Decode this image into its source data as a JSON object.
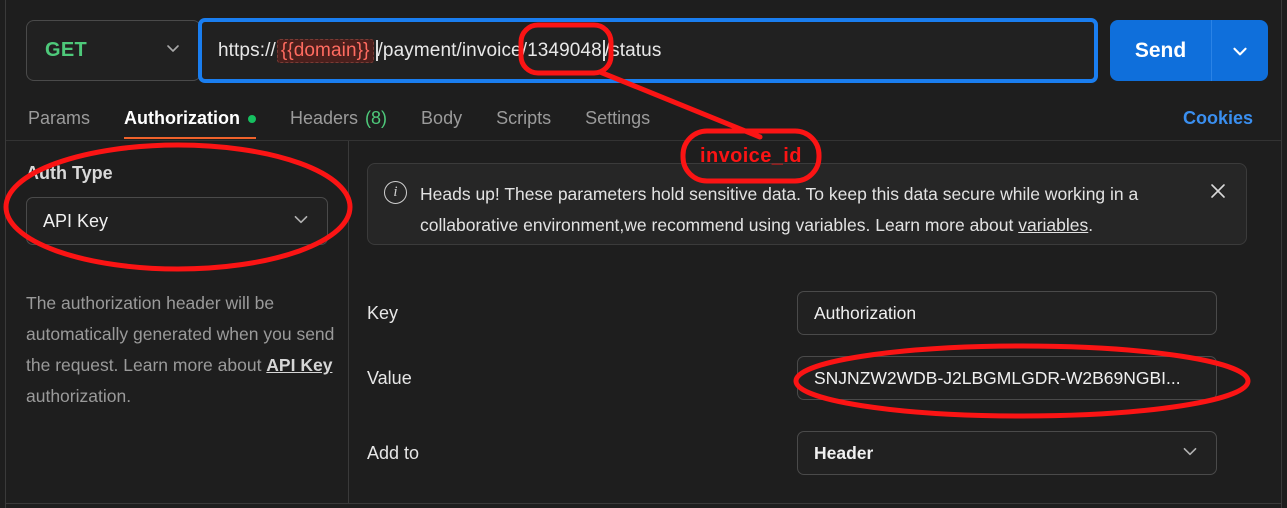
{
  "request_bar": {
    "method": "GET",
    "method_caret_icon": "chevron-down-icon",
    "url_prefix": "https://",
    "url_variable": "{{domain}}",
    "url_suffix": "/payment/invoice/1349048/status",
    "url_path_before_id": "/payment/invoice",
    "url_invoice_id": "/1349048",
    "url_path_after_id": "/status",
    "send_label": "Send",
    "send_caret_icon": "chevron-down-icon"
  },
  "tabs": {
    "items": [
      {
        "label": "Params",
        "active": false,
        "dot": false,
        "count": ""
      },
      {
        "label": "Authorization",
        "active": true,
        "dot": true,
        "count": ""
      },
      {
        "label": "Headers",
        "active": false,
        "dot": false,
        "count": "(8)"
      },
      {
        "label": "Body",
        "active": false,
        "dot": false,
        "count": ""
      },
      {
        "label": "Scripts",
        "active": false,
        "dot": false,
        "count": ""
      },
      {
        "label": "Settings",
        "active": false,
        "dot": false,
        "count": ""
      }
    ],
    "cookies_label": "Cookies"
  },
  "auth_panel": {
    "auth_type_label": "Auth Type",
    "auth_type_value": "API Key",
    "auth_type_caret_icon": "chevron-down-icon",
    "helper_text_part1": "The authorization header will be automatically generated when you send the request. Learn more about ",
    "helper_link": "API Key",
    "helper_text_part2": " authorization."
  },
  "notice": {
    "icon": "info-circle-icon",
    "text_part1": "Heads up! These parameters hold sensitive data. To keep this data secure while working in a collaborative environment,we recommend using variables. Learn more about ",
    "link": "variables",
    "text_part2": ".",
    "close_icon": "close-icon"
  },
  "fields": [
    {
      "label": "Key",
      "value": "Authorization",
      "type": "text",
      "caret_icon": ""
    },
    {
      "label": "Value",
      "value": "SNJNZW2WDB-J2LBGMLGDR-W2B69NGBI...",
      "type": "text",
      "caret_icon": ""
    },
    {
      "label": "Add to",
      "value": "Header",
      "type": "select",
      "caret_icon": "chevron-down-icon"
    }
  ],
  "annotations": {
    "invoice_id_label": "invoice_id",
    "highlight_color": "#fb1414",
    "url_focus_color": "#1a7ef0"
  }
}
